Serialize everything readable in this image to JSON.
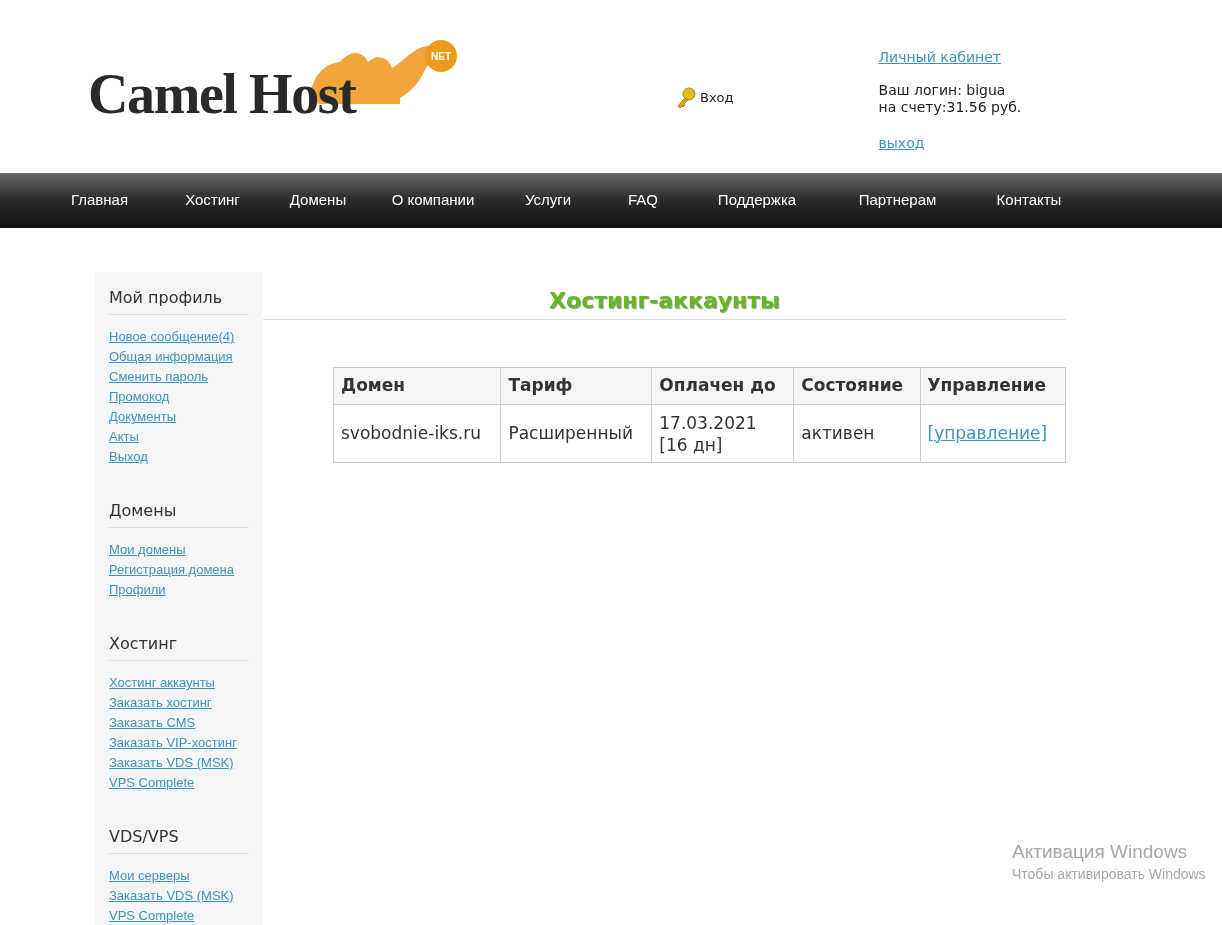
{
  "logo": {
    "text": "Camel Host",
    "badge": "NET"
  },
  "login_link": "Вход",
  "account": {
    "cabinet_link": "Личный кабинет",
    "login_line": "Ваш логин: bigua",
    "balance_line": "на счету:31.56 руб.",
    "logout_link": "выход"
  },
  "nav": [
    "Главная",
    "Хостинг",
    "Домены",
    "О компании",
    "Услуги",
    "FAQ",
    "Поддержка",
    "Партнерам",
    "Контакты"
  ],
  "sidebar": [
    {
      "title": "Мой профиль",
      "links": [
        "Новое сообщение(4)",
        "Общая информация",
        "Сменить пароль",
        "Промокод",
        "Документы",
        "Акты",
        "Выход"
      ]
    },
    {
      "title": "Домены",
      "links": [
        "Мои домены",
        "Регистрация домена",
        "Профили"
      ]
    },
    {
      "title": "Хостинг",
      "links": [
        "Хостинг аккаунты",
        "Заказать хостинг",
        "Заказать CMS",
        "Заказать VIP-хостинг",
        "Заказать VDS (MSK)",
        "VPS Complete"
      ]
    },
    {
      "title": "VDS/VPS",
      "links": [
        "Мои серверы",
        "Заказать VDS (MSK)",
        "VPS Complete"
      ]
    }
  ],
  "page_title": "Хостинг-аккаунты",
  "table": {
    "columns": [
      "Домен",
      "Тариф",
      "Оплачен до",
      "Состояние",
      "Управление"
    ],
    "rows": [
      {
        "domain": "svobodnie-iks.ru",
        "plan": "Расширенный",
        "paid_until": "17.03.2021",
        "days_left": "[16 дн]",
        "status": "активен",
        "manage_link": "[управление]"
      }
    ]
  },
  "windows_notice": {
    "title": "Активация Windows",
    "text": "Чтобы активировать Windows"
  }
}
